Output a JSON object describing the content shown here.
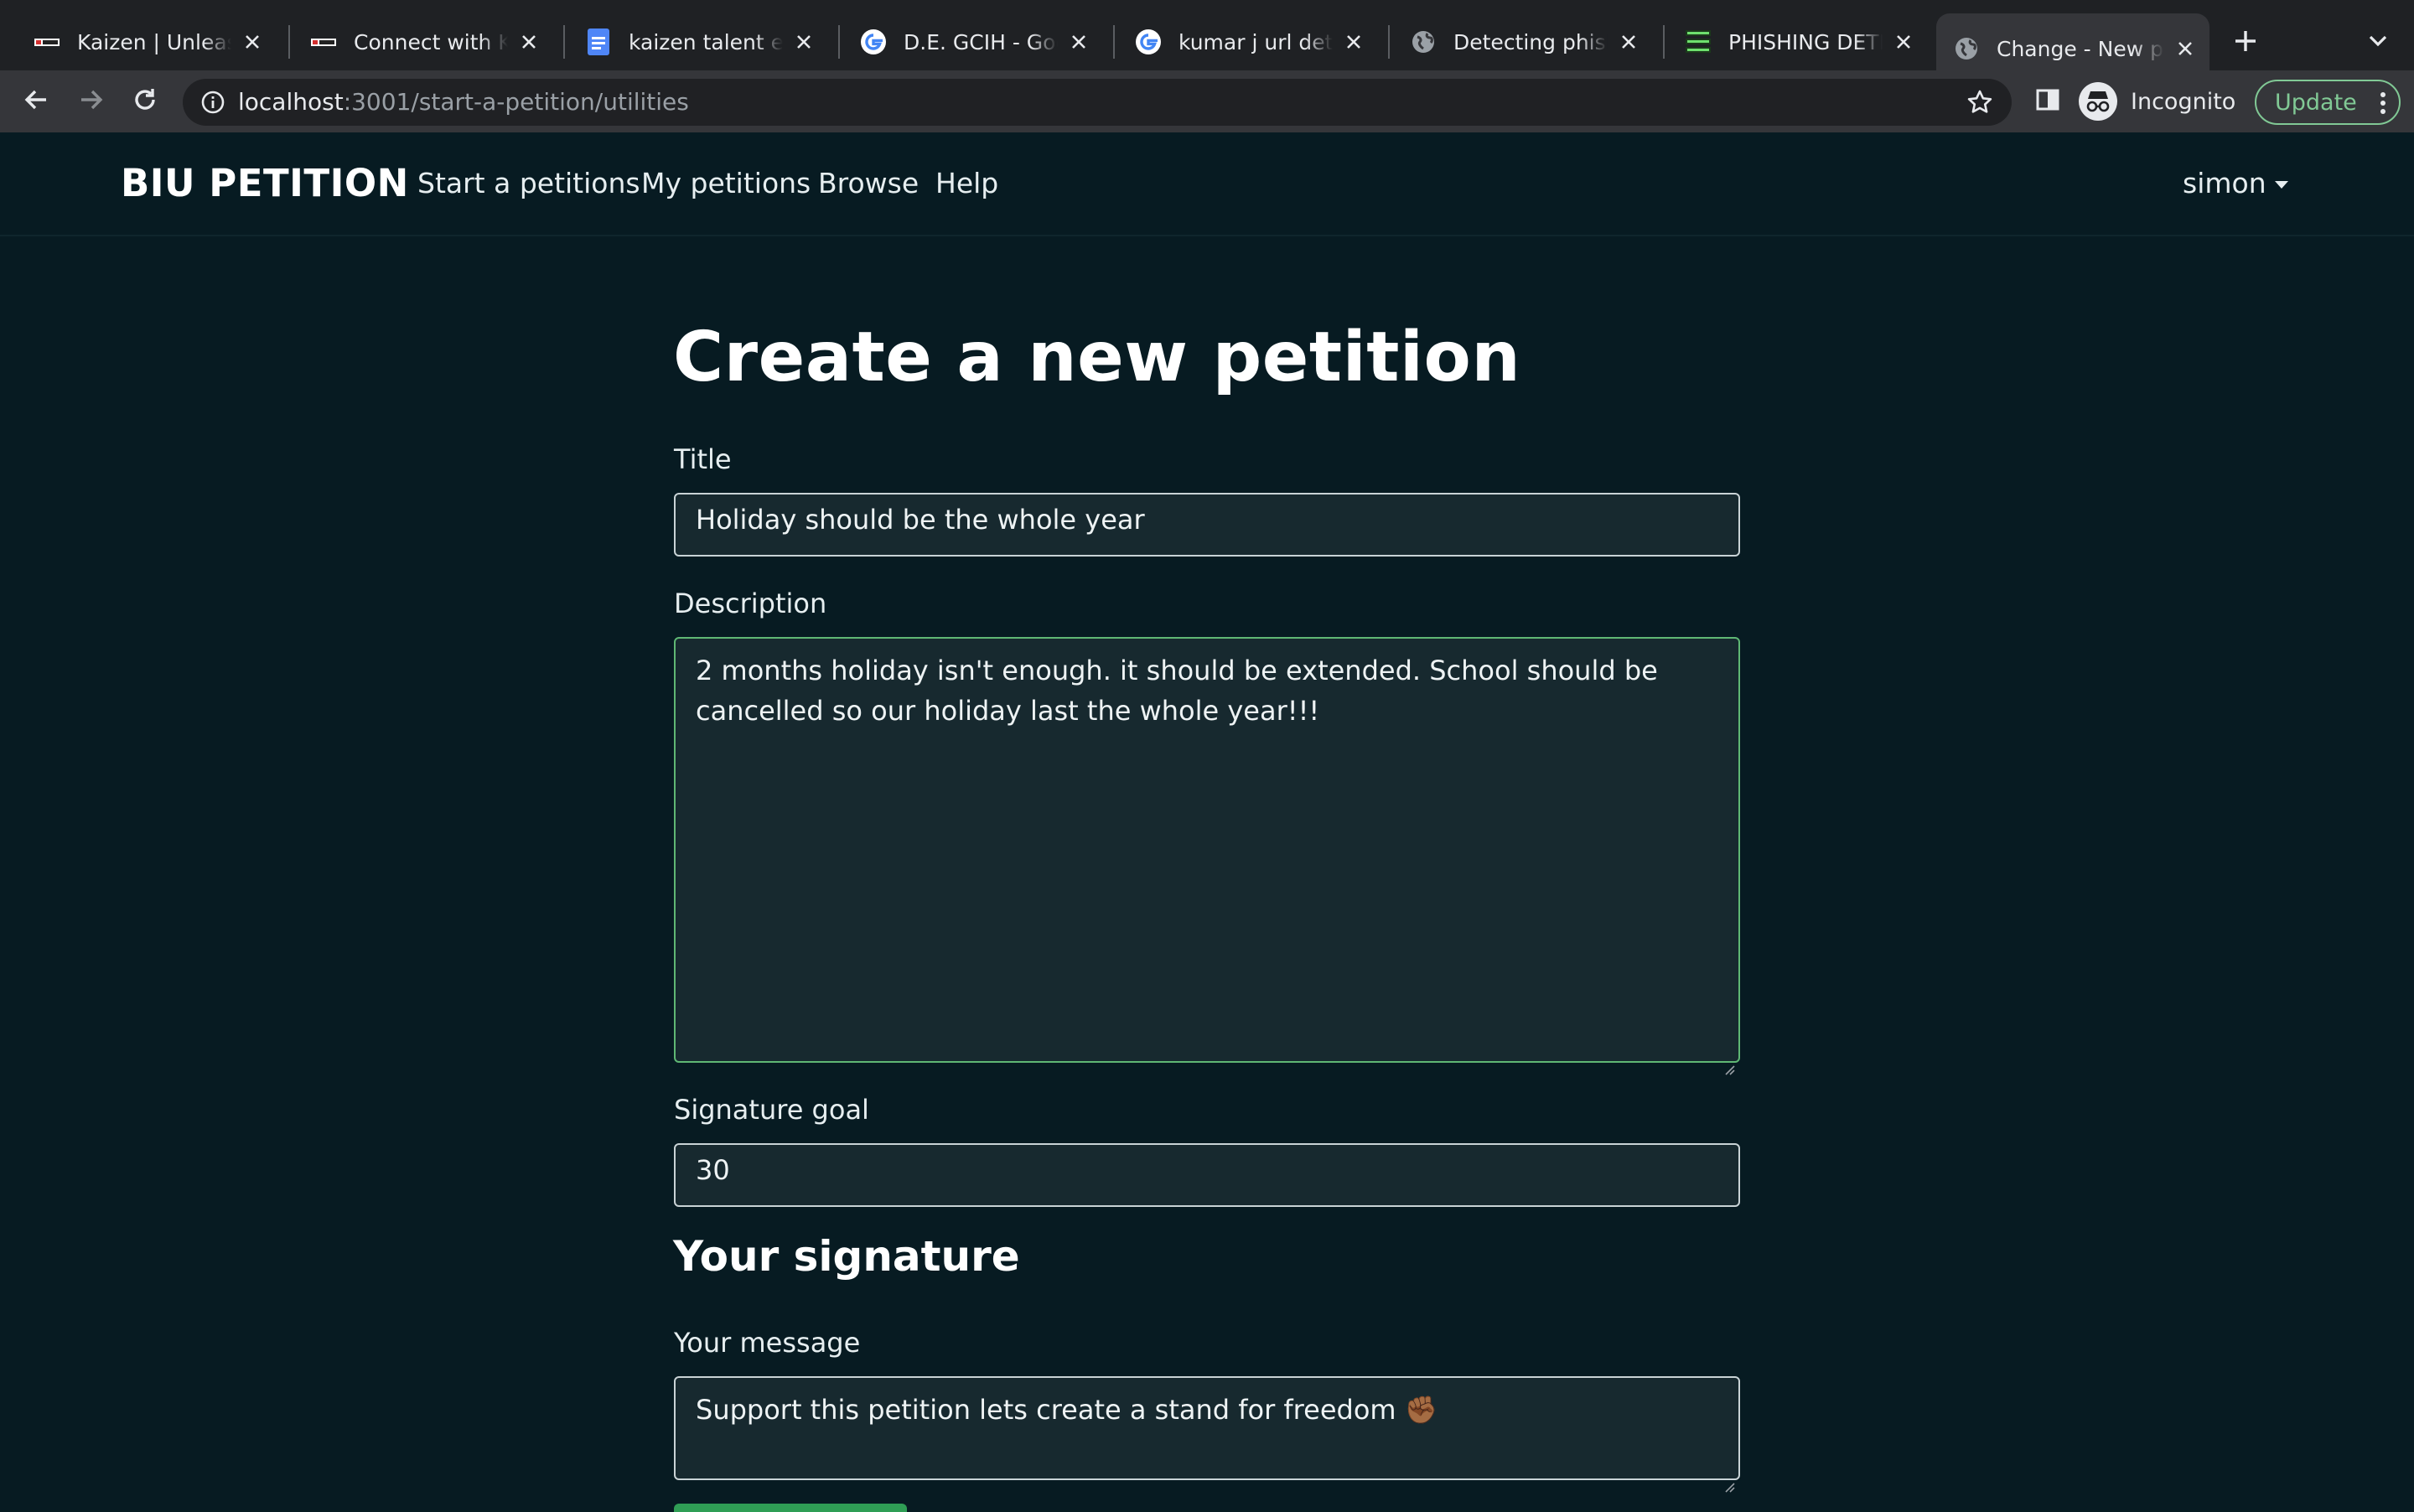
{
  "browser": {
    "tabs": [
      {
        "title": "Kaizen | Unleashing",
        "favicon": "kaizen-logo-icon",
        "active": false
      },
      {
        "title": "Connect with Kaizen",
        "favicon": "kaizen-logo-icon",
        "active": false
      },
      {
        "title": "kaizen talent editor",
        "favicon": "google-docs-icon",
        "active": false
      },
      {
        "title": "D.E. GCIH - Google",
        "favicon": "google-icon",
        "active": false
      },
      {
        "title": "kumar j url detection",
        "favicon": "google-icon",
        "active": false
      },
      {
        "title": "Detecting phishing",
        "favicon": "globe-icon",
        "active": false
      },
      {
        "title": "PHISHING DETECTION",
        "favicon": "spam-icon",
        "active": false
      },
      {
        "title": "Change - New petition",
        "favicon": "globe-icon",
        "active": true
      }
    ],
    "url_host": "localhost",
    "url_path": ":3001/start-a-petition/utilities",
    "profile_label": "Incognito",
    "update_label": "Update",
    "colors": {
      "update": "#81c995",
      "tab_bg": "#1f2124",
      "toolbar_bg": "#35363a"
    }
  },
  "nav": {
    "brand": "BIU PETITION",
    "links": [
      "Start a petitions",
      "My petitions",
      "Browse",
      "Help"
    ],
    "user": "simon"
  },
  "form": {
    "heading": "Create a new petition",
    "title_label": "Title",
    "title_value": "Holiday should be the whole year",
    "description_label": "Description",
    "description_value": "2 months holiday isn't enough. it should be extended. School should be cancelled so our holiday last the whole year!!!",
    "goal_label": "Signature goal",
    "goal_value": "30",
    "signature_heading": "Your signature",
    "message_label": "Your message",
    "message_value": "Support this petition lets create a stand for freedom ✊🏾",
    "colors": {
      "page_bg": "#071b22",
      "field_bg": "#17292f",
      "focus_border": "#5fb874",
      "submit": "#2f9e55"
    }
  }
}
